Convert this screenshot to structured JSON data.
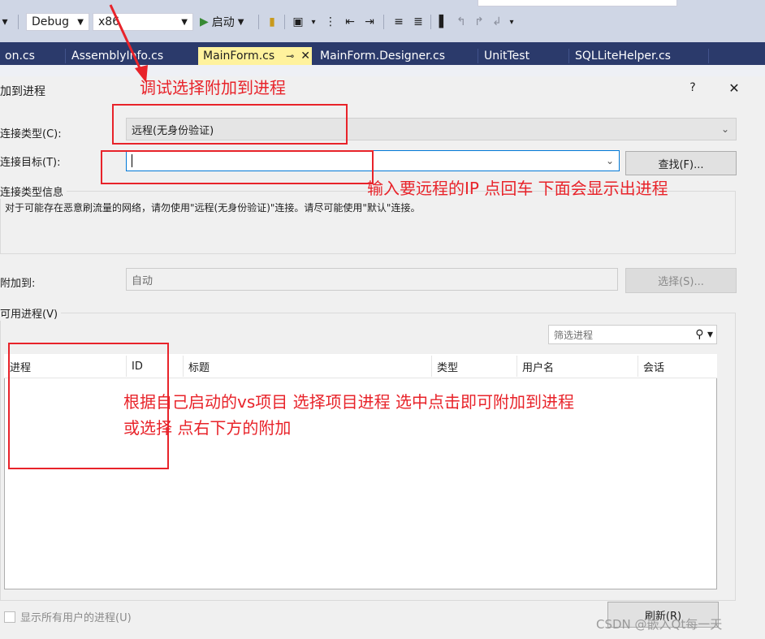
{
  "toolbar": {
    "config_combo": "Debug",
    "platform_combo": "x86",
    "start_label": "启动"
  },
  "tabs": [
    {
      "label": "on.cs"
    },
    {
      "label": "AssemblyInfo.cs"
    },
    {
      "label": "MainForm.cs"
    },
    {
      "label": "MainForm.Designer.cs"
    },
    {
      "label": "UnitTest"
    },
    {
      "label": "SQLLiteHelper.cs"
    }
  ],
  "dialog": {
    "title": "加到进程",
    "help_label": "?",
    "close_label": "✕",
    "connection_type_label": "连接类型(C):",
    "connection_type_value": "远程(无身份验证)",
    "connection_target_label": "连接目标(T):",
    "connection_target_value": "",
    "find_button": "查找(F)...",
    "info_group_title": "连接类型信息",
    "info_text": "对于可能存在恶意刷流量的网络，请勿使用\"远程(无身份验证)\"连接。请尽可能使用\"默认\"连接。",
    "attach_to_label": "附加到:",
    "attach_to_value": "自动",
    "select_button": "选择(S)...",
    "available_group_title": "可用进程(V)",
    "filter_placeholder": "筛选进程",
    "columns": [
      "进程",
      "ID",
      "标题",
      "类型",
      "用户名",
      "会话"
    ],
    "show_all_users_label": "显示所有用户的进程(U)",
    "refresh_button": "刷新(R)"
  },
  "annotations": {
    "top": "调试选择附加到进程",
    "middle": "输入要远程的IP 点回车 下面会显示出进程",
    "bottom_line1": "根据自己启动的vs项目 选择项目进程 选中点击即可附加到进程",
    "bottom_line2": "或选择 点右下方的附加"
  },
  "watermark": "CSDN @嵌入Qt每一天",
  "colors": {
    "annotation": "#e8232a",
    "tab_bar": "#2b3a6b",
    "active_tab": "#fff29d",
    "dialog_bg": "#f0f0f0"
  }
}
